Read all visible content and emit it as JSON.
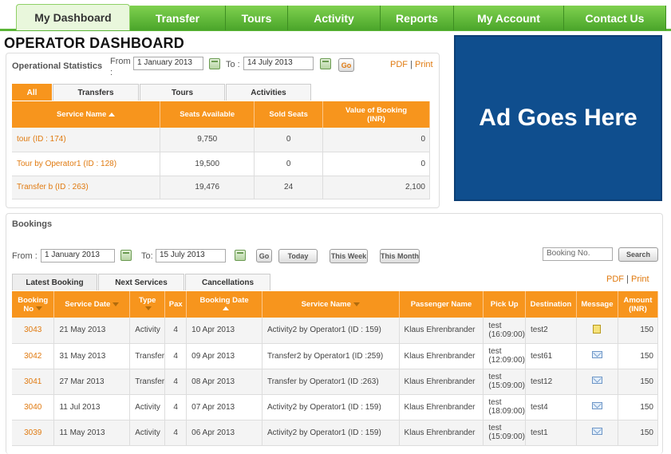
{
  "nav": [
    "My Dashboard",
    "Transfer",
    "Tours",
    "Activity",
    "Reports",
    "My Account",
    "Contact Us"
  ],
  "page_title": "OPERATOR DASHBOARD",
  "stats": {
    "title": "Operational Statistics",
    "from_label": "From :",
    "from_value": "1 January 2013",
    "to_label": "To :",
    "to_value": "14 July 2013",
    "go": "Go",
    "pdf": "PDF",
    "print": "Print",
    "tabs": [
      "All",
      "Transfers",
      "Tours",
      "Activities"
    ],
    "columns": [
      "Service Name",
      "Seats Available",
      "Sold Seats",
      "Value of Booking (INR)"
    ],
    "rows": [
      {
        "name": "tour (ID : 174)",
        "seats": "9,750",
        "sold": "0",
        "value": "0"
      },
      {
        "name": "Tour by Operator1 (ID : 128)",
        "seats": "19,500",
        "sold": "0",
        "value": "0"
      },
      {
        "name": "Transfer b (ID : 263)",
        "seats": "19,476",
        "sold": "24",
        "value": "2,100"
      }
    ]
  },
  "ad": {
    "text": "Ad Goes Here"
  },
  "bookings": {
    "title": "Bookings",
    "from_label": "From :",
    "from_value": "1 January 2013",
    "to_label": "To:",
    "to_value": "15 July 2013",
    "go": "Go",
    "today": "Today",
    "this_week": "This Week",
    "this_month": "This Month",
    "search_placeholder": "Booking No.",
    "search": "Search",
    "pdf": "PDF",
    "print": "Print",
    "tabs": [
      "Latest Booking",
      "Next Services",
      "Cancellations"
    ],
    "columns": [
      "Booking No",
      "Service Date",
      "Type",
      "Pax",
      "Booking Date",
      "Service Name",
      "Passenger Name",
      "Pick Up",
      "Destination",
      "Message",
      "Amount (INR)"
    ],
    "rows": [
      {
        "no": "3043",
        "sdate": "21 May 2013",
        "type": "Activity",
        "pax": "4",
        "bdate": "10 Apr 2013",
        "service": "Activity2 by Operator1 (ID : 159)",
        "passenger": "Klaus Ehrenbrander",
        "pickup1": "test",
        "pickup2": "(16:09:00)",
        "dest": "test2",
        "msg": "note-icon",
        "amount": "150"
      },
      {
        "no": "3042",
        "sdate": "31 May 2013",
        "type": "Transfer",
        "pax": "4",
        "bdate": "09 Apr 2013",
        "service": "Transfer2 by Operator1 (ID :259)",
        "passenger": "Klaus Ehrenbrander",
        "pickup1": "test",
        "pickup2": "(12:09:00)",
        "dest": "test61",
        "msg": "mail-icon",
        "amount": "150"
      },
      {
        "no": "3041",
        "sdate": "27 Mar 2013",
        "type": "Transfer",
        "pax": "4",
        "bdate": "08 Apr 2013",
        "service": "Transfer by Operator1 (ID :263)",
        "passenger": "Klaus Ehrenbrander",
        "pickup1": "test",
        "pickup2": "(15:09:00)",
        "dest": "test12",
        "msg": "mail-icon",
        "amount": "150"
      },
      {
        "no": "3040",
        "sdate": "11 Jul 2013",
        "type": "Activity",
        "pax": "4",
        "bdate": "07 Apr 2013",
        "service": "Activity2 by Operator1 (ID : 159)",
        "passenger": "Klaus Ehrenbrander",
        "pickup1": "test",
        "pickup2": "(18:09:00)",
        "dest": "test4",
        "msg": "mail-icon",
        "amount": "150"
      },
      {
        "no": "3039",
        "sdate": "11 May 2013",
        "type": "Activity",
        "pax": "4",
        "bdate": "06 Apr 2013",
        "service": "Activity2 by Operator1 (ID : 159)",
        "passenger": "Klaus Ehrenbrander",
        "pickup1": "test",
        "pickup2": "(15:09:00)",
        "dest": "test1",
        "msg": "mail-icon",
        "amount": "150"
      }
    ]
  }
}
